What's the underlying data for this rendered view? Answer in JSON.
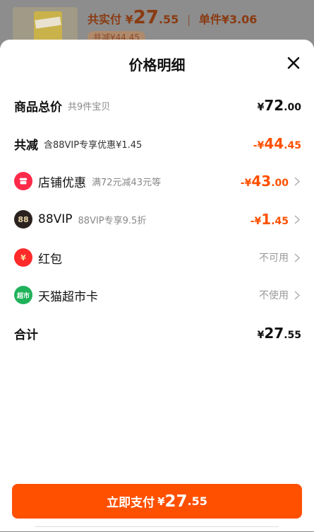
{
  "background": {
    "price_prefix": "共实付",
    "price_currency": "¥",
    "price_int": "27",
    "price_dec": ".55",
    "unit_label": "单件¥3.06",
    "sub_label": "共减¥44.45"
  },
  "sheet": {
    "title": "价格明细",
    "rows": [
      {
        "name": "商品总价",
        "note": "共9件宝贝",
        "cur": "¥",
        "int": "72",
        "dec": ".00"
      },
      {
        "name": "共减",
        "note": "含88VIP专享优惠¥1.45",
        "cur": "-¥",
        "int": "44",
        "dec": ".45"
      },
      {
        "name": "店铺优惠",
        "note": "满72元减43元等",
        "cur": "-¥",
        "int": "43",
        "dec": ".00"
      },
      {
        "name": "88VIP",
        "note": "88VIP专享9.5折",
        "cur": "-¥",
        "int": "1",
        "dec": ".45",
        "icon_text": "88"
      },
      {
        "name": "红包",
        "status": "不可用",
        "icon_text": "¥"
      },
      {
        "name": "天猫超市卡",
        "status": "不使用",
        "icon_text": "超市"
      },
      {
        "name": "合计",
        "cur": "¥",
        "int": "27",
        "dec": ".55"
      }
    ]
  },
  "pay": {
    "label": "立即支付",
    "cur": "¥",
    "int": "27",
    "dec": ".55"
  },
  "colors": {
    "accent": "#ff5000",
    "text": "#111111",
    "muted": "#888888"
  }
}
